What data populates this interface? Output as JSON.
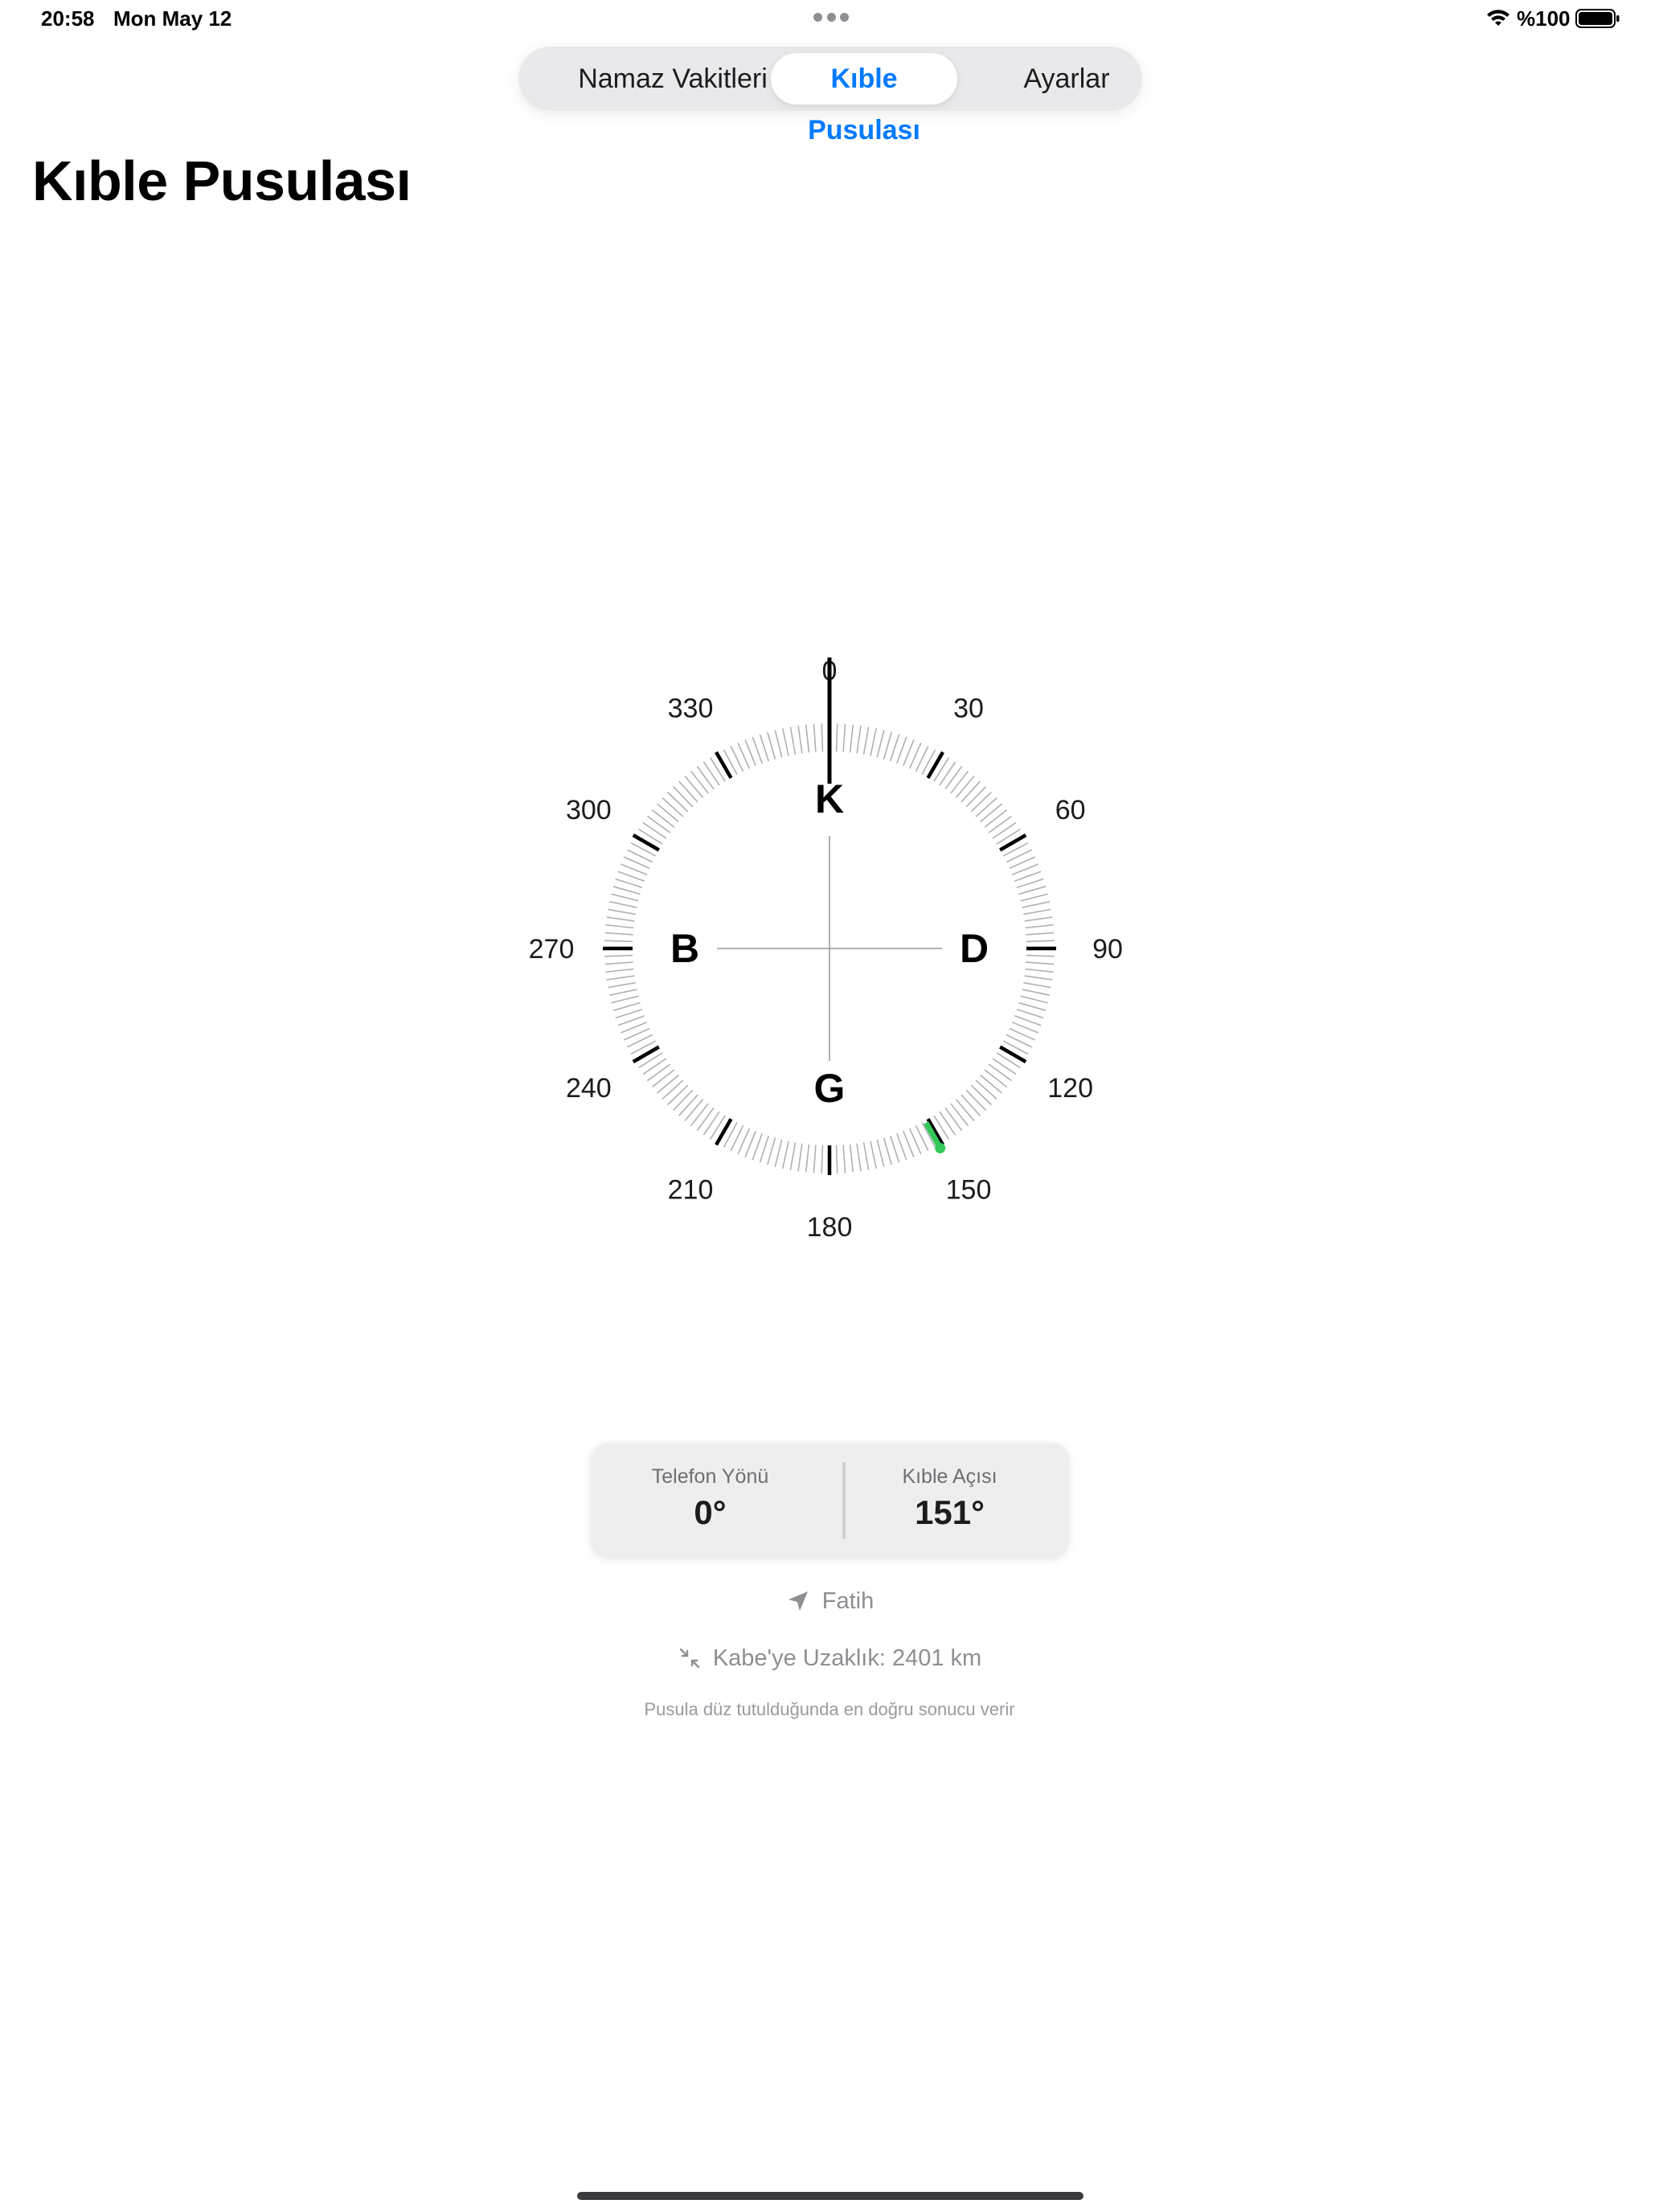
{
  "status_bar": {
    "time": "20:58",
    "date": "Mon May 12",
    "battery_text": "%100",
    "icons": [
      "wifi-icon",
      "battery-icon",
      "multitask-dots-icon"
    ]
  },
  "tabs": [
    {
      "label": "Namaz Vakitleri",
      "active": false
    },
    {
      "label": "Kıble Pusulası",
      "active": true
    },
    {
      "label": "Ayarlar",
      "active": false
    }
  ],
  "page": {
    "title": "Kıble Pusulası"
  },
  "compass": {
    "heading_deg": 0,
    "qibla_deg": 151,
    "degree_labels": [
      "0",
      "30",
      "60",
      "90",
      "120",
      "150",
      "180",
      "210",
      "240",
      "270",
      "300",
      "330"
    ],
    "cardinals": {
      "north": "K",
      "east": "D",
      "south": "G",
      "west": "B"
    },
    "colors": {
      "needle": "#000000",
      "qibla": "#34c759",
      "minor_tick": "#b0b0b4",
      "major_tick": "#000000",
      "crosshair": "#9a9a9e"
    }
  },
  "info_card": {
    "phone_heading_label": "Telefon Yönü",
    "phone_heading_value": "0°",
    "qibla_angle_label": "Kıble Açısı",
    "qibla_angle_value": "151°"
  },
  "location": {
    "icon": "location-arrow-icon",
    "city": "Fatih"
  },
  "distance": {
    "icon": "arrows-inward-icon",
    "text": "Kabe'ye Uzaklık: 2401 km"
  },
  "hint": "Pusula düz tutulduğunda en doğru sonucu verir",
  "accent_color": "#007aff"
}
